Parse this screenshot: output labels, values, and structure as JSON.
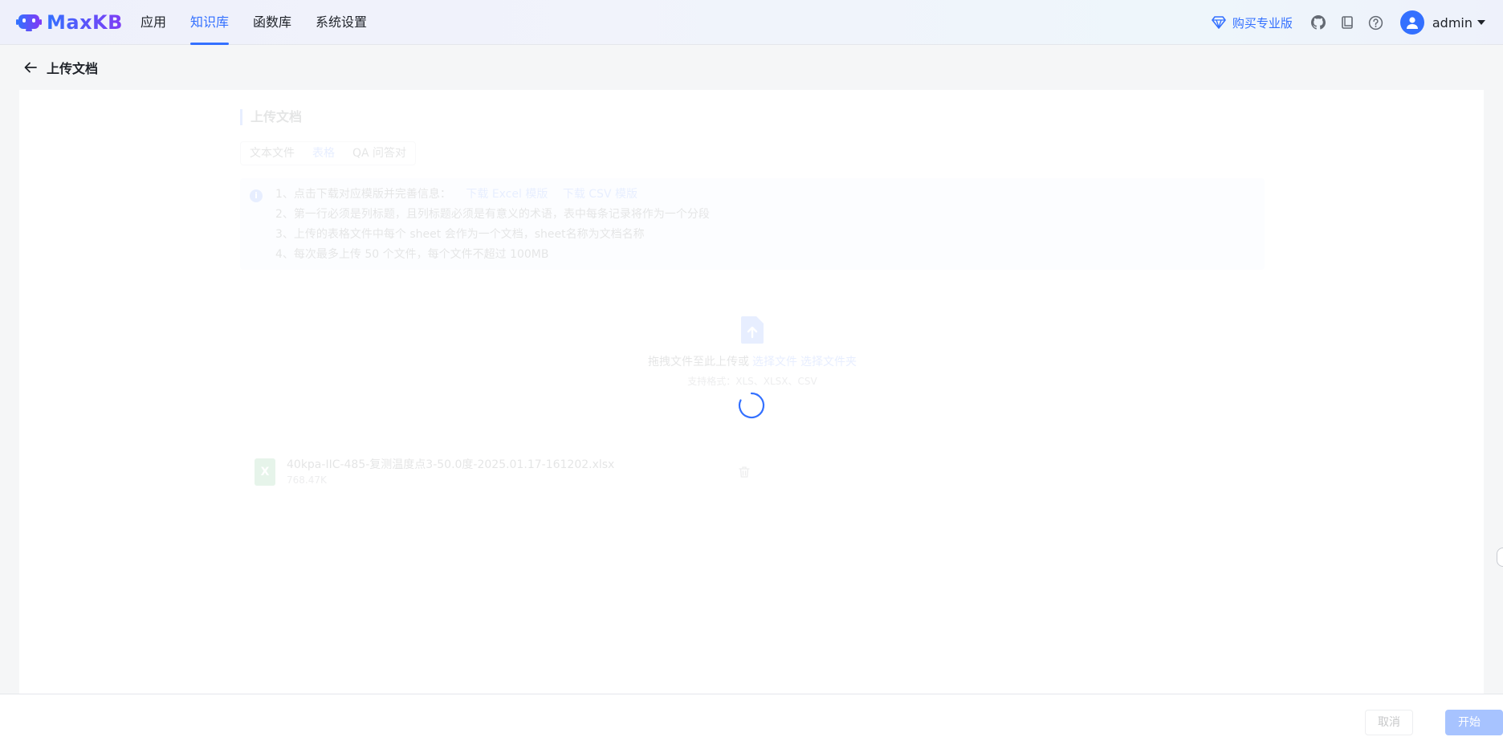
{
  "header": {
    "logo_text": "MaxKB",
    "nav": [
      {
        "label": "应用",
        "active": false
      },
      {
        "label": "知识库",
        "active": true
      },
      {
        "label": "函数库",
        "active": false
      },
      {
        "label": "系统设置",
        "active": false
      }
    ],
    "pro_label": "购买专业版",
    "user_name": "admin"
  },
  "page": {
    "title": "上传文档"
  },
  "upload_form": {
    "section_title": "上传文档",
    "tabs": [
      {
        "label": "文本文件",
        "active": false
      },
      {
        "label": "表格",
        "active": true
      },
      {
        "label": "QA 问答对",
        "active": false
      }
    ],
    "info": {
      "line1_text": "1、点击下载对应模版并完善信息：",
      "download_excel": "下载 Excel 模版",
      "download_csv": "下载 CSV 模版",
      "line2": "2、第一行必须是列标题，且列标题必须是有意义的术语，表中每条记录将作为一个分段",
      "line3": "3、上传的表格文件中每个 sheet 会作为一个文档，sheet名称为文档名称",
      "line4": "4、每次最多上传 50 个文件，每个文件不超过 100MB"
    },
    "upload_area": {
      "text": "拖拽文件至此上传或",
      "select_file": "选择文件",
      "select_folder": "选择文件夹",
      "tip": "支持格式：XLS、XLSX、CSV"
    },
    "file": {
      "name": "40kpa-IIC-485-复测温度点3-50.0度-2025.01.17-161202.xlsx",
      "size": "768.47K",
      "icon_letter": "X"
    }
  },
  "footer": {
    "cancel_label": "取消",
    "import_label": "开始导入"
  },
  "colors": {
    "primary": "#3370ff",
    "excel_green": "#2ca24b"
  }
}
